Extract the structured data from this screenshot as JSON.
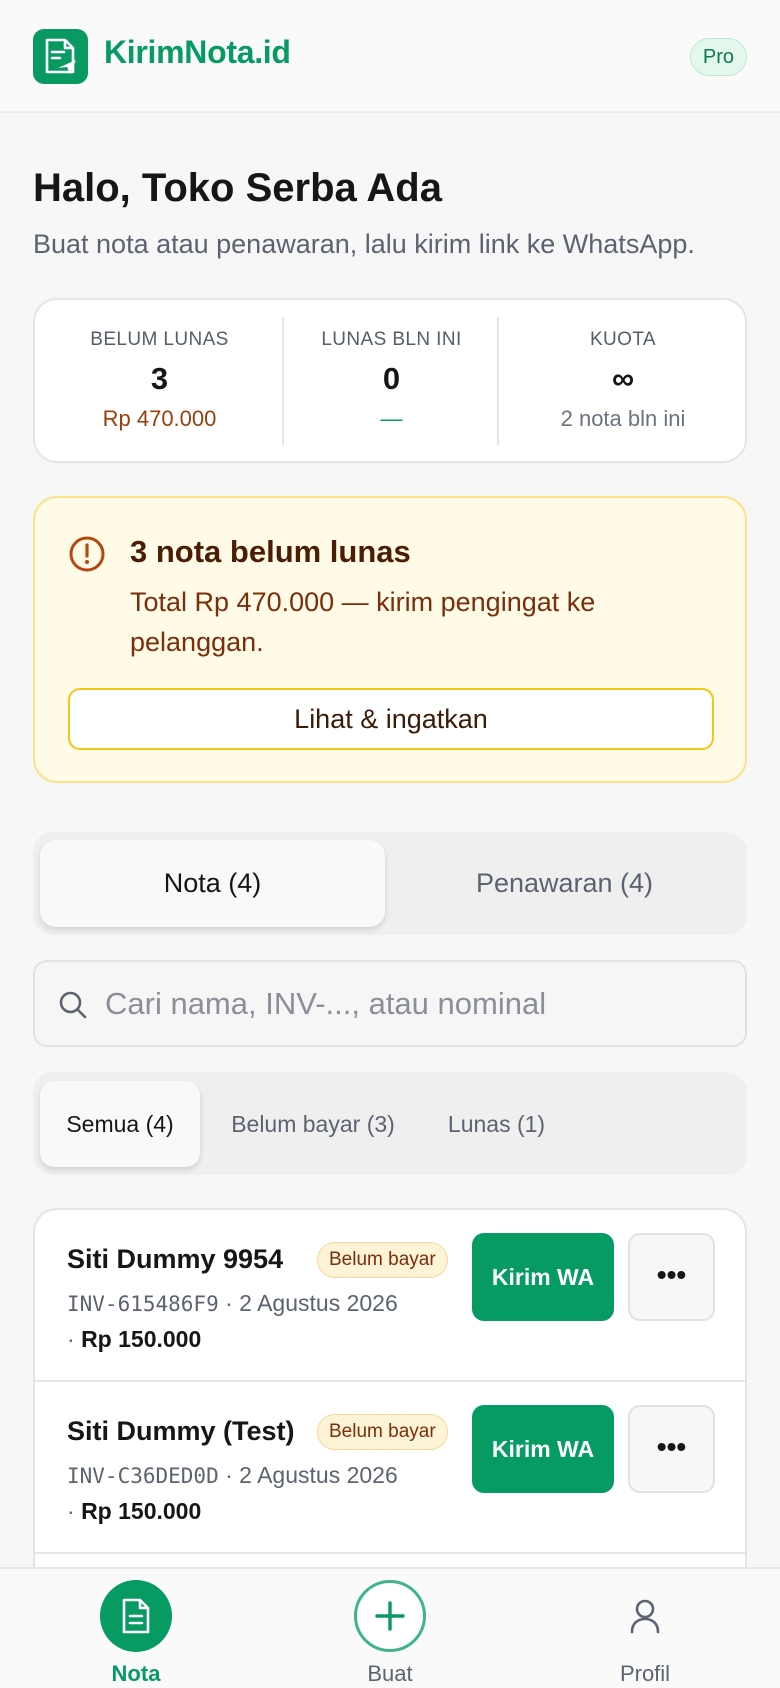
{
  "header": {
    "brand": "KirimNota.id",
    "badge": "Pro",
    "logo_icon": "document-send-icon"
  },
  "greeting": {
    "title": "Halo, Toko Serba Ada",
    "subtitle": "Buat nota atau penawaran, lalu kirim link ke WhatsApp."
  },
  "stats": [
    {
      "label": "BELUM LUNAS",
      "value": "3",
      "sub": "Rp 470.000"
    },
    {
      "label": "LUNAS BLN INI",
      "value": "0",
      "sub": "—"
    },
    {
      "label": "KUOTA",
      "value": "∞",
      "sub": "2 nota bln ini"
    }
  ],
  "alert": {
    "icon": "warning-circle-icon",
    "title": "3 nota belum lunas",
    "text": "Total Rp 470.000 — kirim pengingat ke pelanggan.",
    "button": "Lihat & ingatkan",
    "accent": "#fbe28a"
  },
  "tabs": [
    {
      "label": "Nota (4)",
      "active": true
    },
    {
      "label": "Penawaran (4)",
      "active": false
    }
  ],
  "search": {
    "placeholder": "Cari nama, INV-..., atau nominal",
    "value": ""
  },
  "filters": [
    {
      "label": "Semua (4)",
      "active": true
    },
    {
      "label": "Belum bayar (3)",
      "active": false
    },
    {
      "label": "Lunas (1)",
      "active": false
    }
  ],
  "invoices": [
    {
      "name": "Siti Dummy 9954",
      "status": "Belum bayar",
      "code": "INV-615486F9",
      "date": "2 Agustus 2026",
      "amount": "Rp 150.000",
      "action": "Kirim WA",
      "more": "•••"
    },
    {
      "name": "Siti Dummy (Test)",
      "status": "Belum bayar",
      "code": "INV-C36DED0D",
      "date": "2 Agustus 2026",
      "amount": "Rp 150.000",
      "action": "Kirim WA",
      "more": "•••"
    }
  ],
  "bottom_nav": [
    {
      "label": "Nota",
      "icon": "document-icon",
      "active": true
    },
    {
      "label": "Buat",
      "icon": "plus-icon",
      "active": false
    },
    {
      "label": "Profil",
      "icon": "user-icon",
      "active": false
    }
  ],
  "colors": {
    "brand": "#079a62",
    "warning_bg": "#fffbe6",
    "warning_text": "#7c2d0a"
  }
}
